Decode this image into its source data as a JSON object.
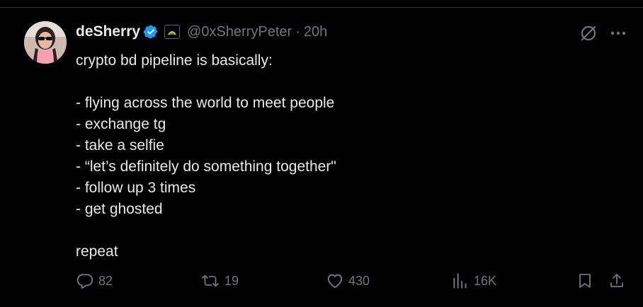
{
  "tweet": {
    "display_name": "deSherry",
    "handle": "@0xSherryPeter",
    "separator": "·",
    "time": "20h",
    "text_lines": [
      "crypto bd pipeline is basically:",
      "",
      "- flying across the world to meet people",
      "- exchange tg",
      "- take a selfie",
      "- “let’s definitely do something together\"",
      "- follow up 3 times",
      "- get ghosted",
      "",
      "repeat"
    ],
    "metrics": {
      "replies": "82",
      "reposts": "19",
      "likes": "430",
      "views": "16K"
    }
  },
  "colors": {
    "background": "#000000",
    "text": "#e7e9ea",
    "muted": "#71767b",
    "verified": "#1d9bf0"
  },
  "icons": {
    "verified": "verified-badge-icon",
    "affiliate": "affiliate-badge-icon",
    "grok": "grok-icon",
    "more": "more-icon",
    "reply": "reply-icon",
    "repost": "repost-icon",
    "like": "like-icon",
    "views": "views-icon",
    "bookmark": "bookmark-icon",
    "share": "share-icon"
  }
}
